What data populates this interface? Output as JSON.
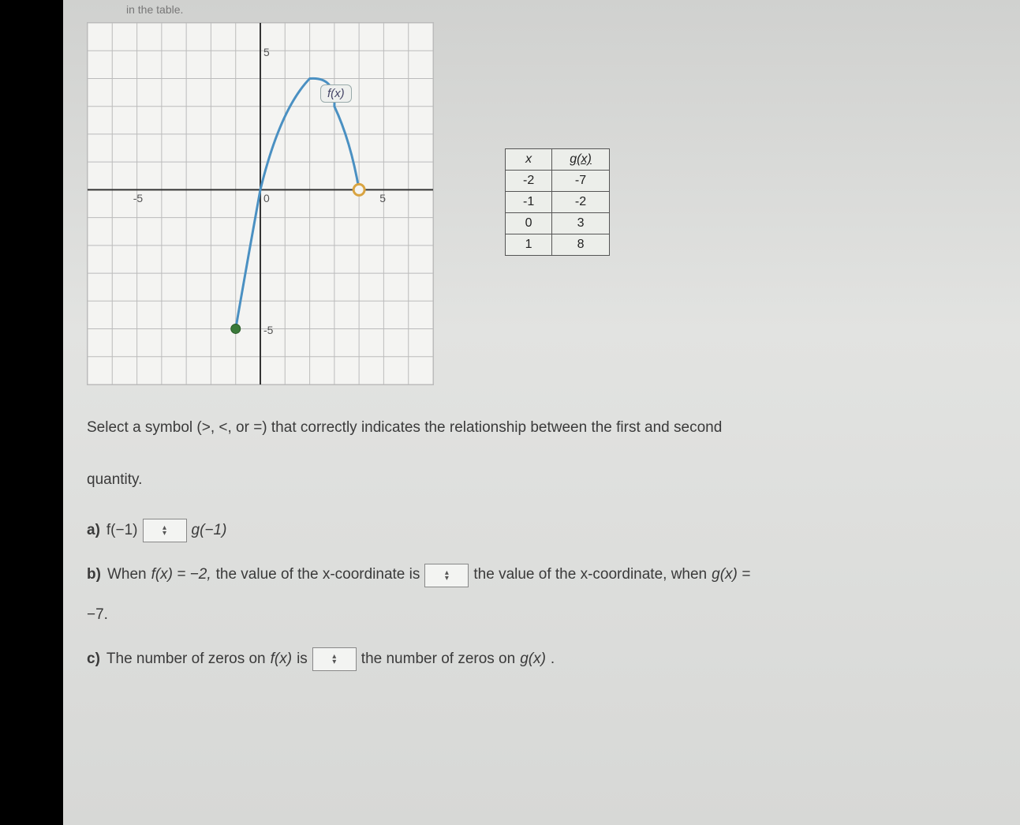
{
  "top_fragment": "in the table.",
  "chart_data": {
    "type": "line",
    "title": "",
    "xlabel": "",
    "ylabel": "",
    "xlim": [
      -7,
      7
    ],
    "ylim": [
      -7,
      6
    ],
    "function_label": "f(x)",
    "axis_ticks": {
      "x": [
        -5,
        0,
        5
      ],
      "y": [
        -5,
        0,
        5
      ]
    },
    "series": [
      {
        "name": "f(x)",
        "points": [
          {
            "x": -1,
            "y": -5,
            "endpoint": "closed"
          },
          {
            "x": 0,
            "y": 0
          },
          {
            "x": 1,
            "y": 3
          },
          {
            "x": 2,
            "y": 4
          },
          {
            "x": 3,
            "y": 3
          },
          {
            "x": 4,
            "y": 0,
            "endpoint": "open"
          }
        ]
      }
    ]
  },
  "gtable": {
    "headers": [
      "x",
      "g(x)"
    ],
    "rows": [
      {
        "x": "-2",
        "gx": "-7"
      },
      {
        "x": "-1",
        "gx": "-2"
      },
      {
        "x": "0",
        "gx": "3"
      },
      {
        "x": "1",
        "gx": "8"
      }
    ]
  },
  "instruction_line1": "Select a symbol (>, <, or =) that correctly indicates the relationship between the first and second",
  "instruction_line2": "quantity.",
  "part_a": {
    "label": "a)",
    "left": "f(−1)",
    "right": "g(−1)"
  },
  "part_b": {
    "label": "b)",
    "pre": "When ",
    "fx_eq": "f(x) = −2,",
    "mid1": " the value of the x-coordinate is ",
    "mid2": " the value of the x-coordinate, when ",
    "gx_eq": "g(x) =",
    "tail": "−7."
  },
  "part_c": {
    "label": "c)",
    "pre": "The number of zeros on ",
    "fx": "f(x)",
    "mid1": " is ",
    "mid2": " the number of zeros on ",
    "gx": "g(x)",
    "tail": "."
  }
}
